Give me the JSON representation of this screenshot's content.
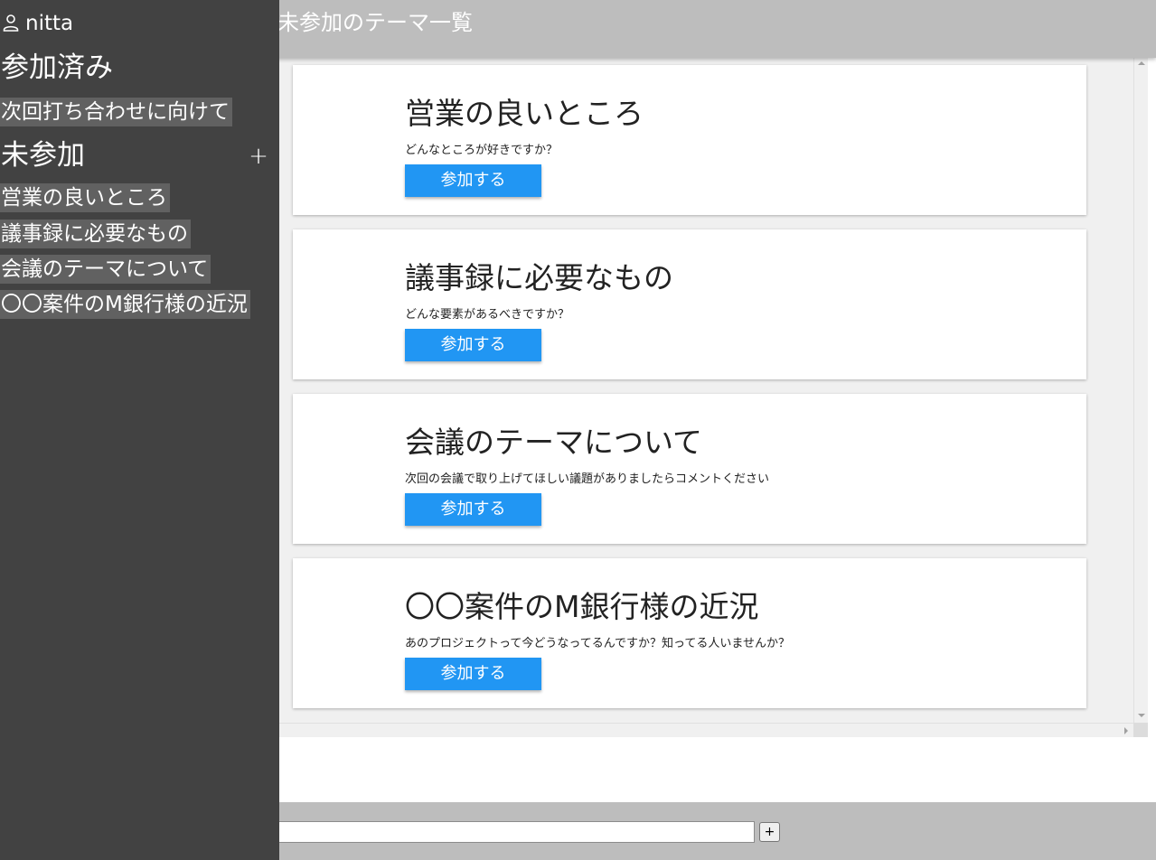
{
  "header": {
    "title": "未参加のテーマ一覧"
  },
  "sidebar": {
    "user": {
      "icon": "person-icon",
      "name": "nitta"
    },
    "joined": {
      "heading": "参加済み",
      "items": [
        "次回打ち合わせに向けて"
      ]
    },
    "not_joined": {
      "heading": "未参加",
      "add_label": "+",
      "items": [
        "営業の良いところ",
        "議事録に必要なもの",
        "会議のテーマについて",
        "〇〇案件のM銀行様の近況"
      ]
    }
  },
  "themes": [
    {
      "title": "営業の良いところ",
      "description": "どんなところが好きですか？",
      "button_label": "参加する"
    },
    {
      "title": "議事録に必要なもの",
      "description": "どんな要素があるべきですか？",
      "button_label": "参加する"
    },
    {
      "title": "会議のテーマについて",
      "description": "次回の会議で取り上げてほしい議題がありましたらコメントください",
      "button_label": "参加する"
    },
    {
      "title": "〇〇案件のM銀行様の近況",
      "description": "あのプロジェクトって今どうなってるんですか？知ってる人いませんか？",
      "button_label": "参加する"
    }
  ],
  "footer": {
    "input_value": "",
    "add_button_label": "+"
  },
  "colors": {
    "sidebar_bg": "#424242",
    "nav_item_bg": "#616161",
    "header_bg": "#bdbdbd",
    "accent": "#2196f3"
  }
}
